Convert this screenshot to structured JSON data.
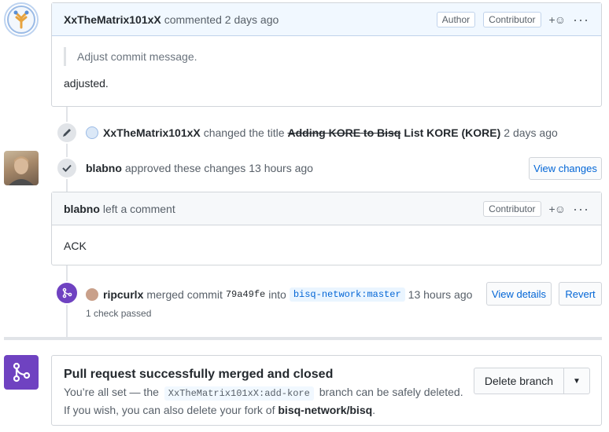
{
  "comment1": {
    "author": "XxTheMatrix101xX",
    "meta": "commented 2 days ago",
    "badges": [
      "Author",
      "Contributor"
    ],
    "reaction_icon": "smiley-plus-icon",
    "quote": "Adjust commit message.",
    "body": "adjusted."
  },
  "rename_event": {
    "actor": "XxTheMatrix101xX",
    "action": "changed the title",
    "old_title": "Adding KORE to Bisq",
    "new_title": "List KORE (KORE)",
    "time": "2 days ago"
  },
  "approve_event": {
    "actor": "blabno",
    "action": "approved these changes",
    "time": "13 hours ago",
    "button": "View changes"
  },
  "comment2": {
    "author": "blabno",
    "meta": "left a comment",
    "badge": "Contributor",
    "body": "ACK"
  },
  "merge_event": {
    "actor": "ripcurlx",
    "action": "merged commit",
    "commit": "79a49fe",
    "into": "into",
    "branch": "bisq-network:master",
    "time": "13 hours ago",
    "checks": "1 check passed",
    "details_button": "View details",
    "revert_button": "Revert"
  },
  "merged_box": {
    "title": "Pull request successfully merged and closed",
    "line1_prefix": "You’re all set — the",
    "line1_branch": "XxTheMatrix101xX:add-kore",
    "line1_suffix": "branch can be safely deleted.",
    "line2_prefix": "If you wish, you can also delete your fork of",
    "line2_repo": "bisq-network/bisq",
    "line2_suffix": ".",
    "delete_button": "Delete branch"
  },
  "colors": {
    "accent": "#0366d6",
    "merged_purple": "#6f42c1",
    "author_header_bg": "#f1f8ff"
  }
}
